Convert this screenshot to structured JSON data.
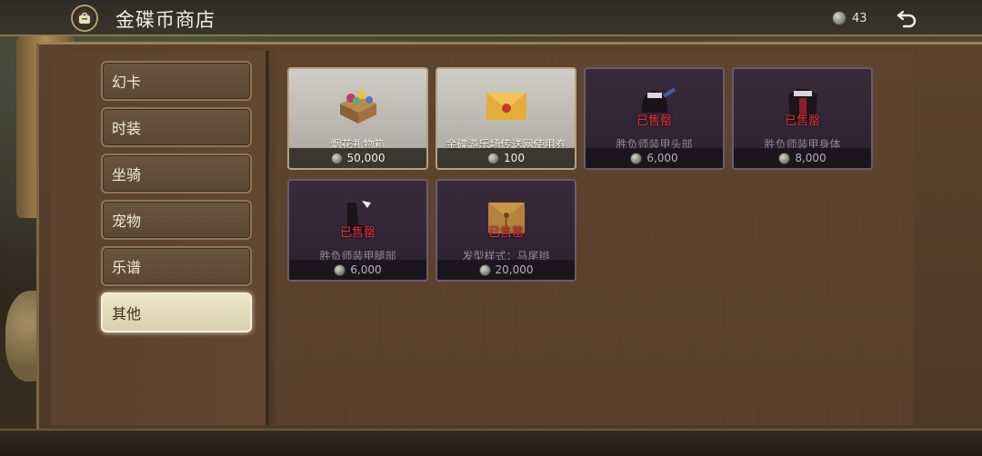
{
  "header": {
    "title": "金碟币商店",
    "coin_count": "43",
    "emblem_icon": "shop-bag-icon",
    "back_icon": "return-arrow-icon"
  },
  "categories": [
    {
      "label": "幻卡",
      "active": false
    },
    {
      "label": "时装",
      "active": false
    },
    {
      "label": "坐骑",
      "active": false
    },
    {
      "label": "宠物",
      "active": false
    },
    {
      "label": "乐谱",
      "active": false
    },
    {
      "label": "其他",
      "active": true
    }
  ],
  "items": [
    {
      "name": "烟花礼物箱",
      "price": "50,000",
      "sold_out": false,
      "icon": "gift-box-icon"
    },
    {
      "name": "金碟游乐场传送网使用券",
      "price": "100",
      "sold_out": false,
      "icon": "envelope-ticket-icon"
    },
    {
      "name": "胜负师装甲头部",
      "price": "6,000",
      "sold_out": true,
      "sold_text": "已售罄",
      "icon": "helmet-icon"
    },
    {
      "name": "胜负师装甲身体",
      "price": "8,000",
      "sold_out": true,
      "sold_text": "已售罄",
      "icon": "armor-body-icon"
    },
    {
      "name": "胜负师装甲腿部",
      "price": "6,000",
      "sold_out": true,
      "sold_text": "已售罄",
      "icon": "boots-icon"
    },
    {
      "name": "发型样式：马尾辫",
      "price": "20,000",
      "sold_out": true,
      "sold_text": "已售罄",
      "icon": "hairstyle-envelope-icon"
    }
  ],
  "colors": {
    "sold_out_text": "#e0323a",
    "active_tab": "#efe6ca"
  }
}
